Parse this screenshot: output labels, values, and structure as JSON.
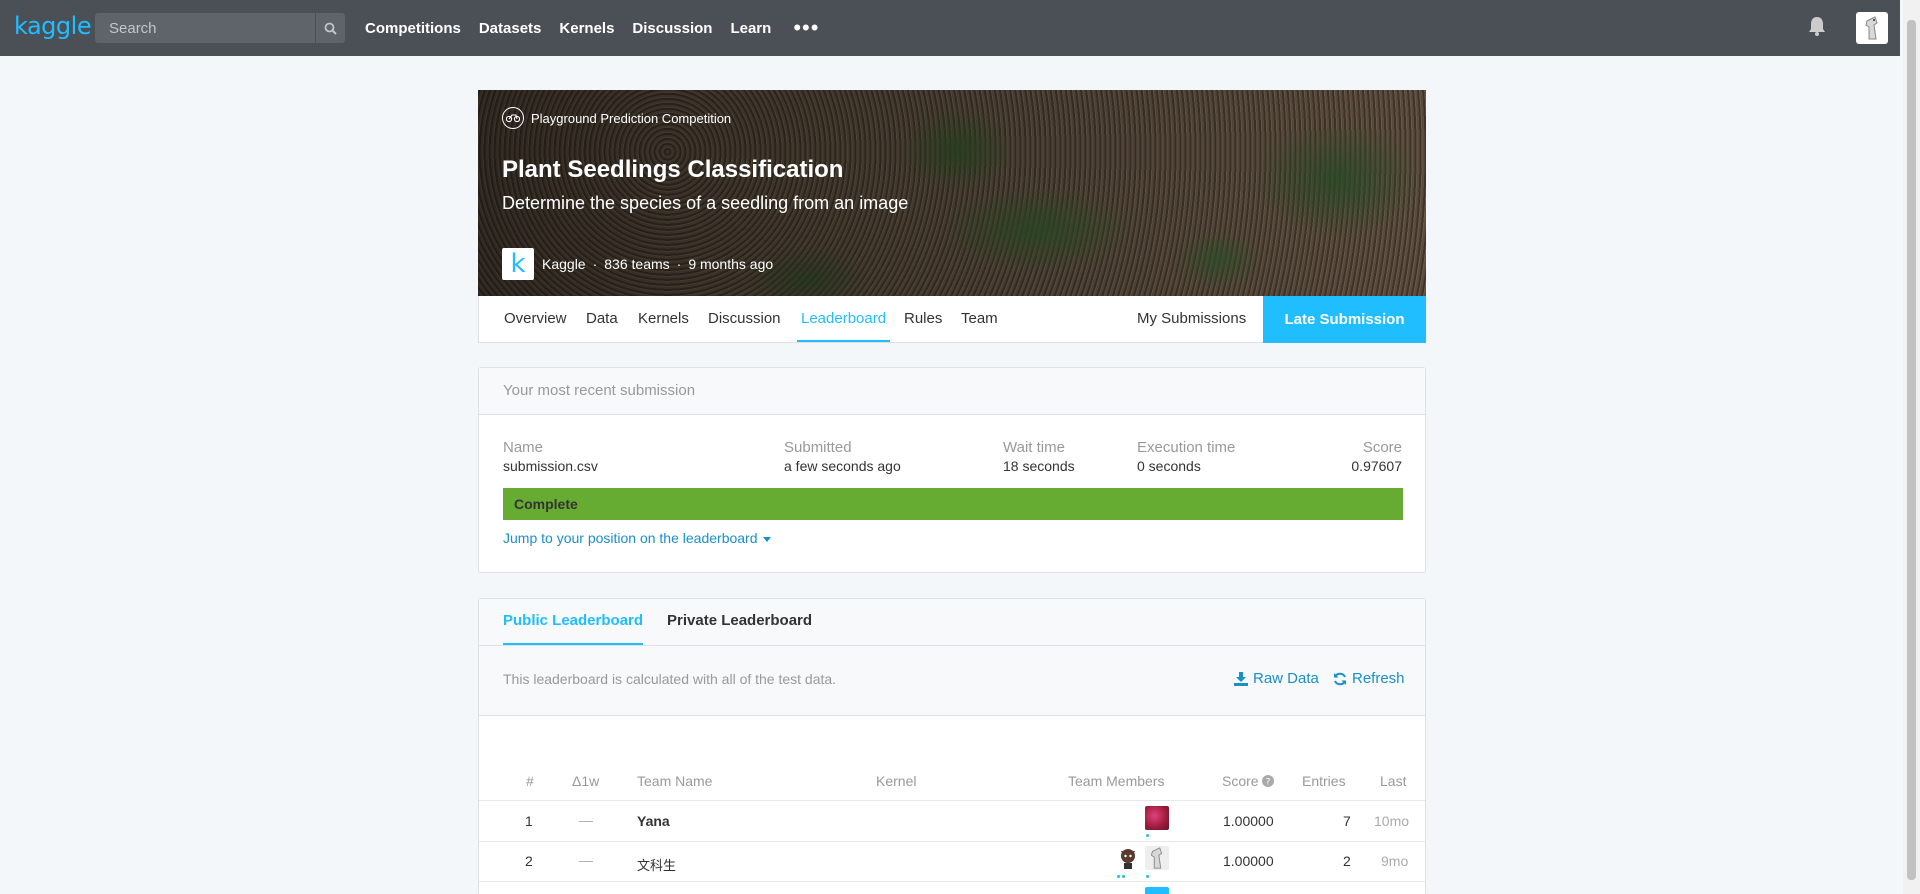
{
  "nav": {
    "logo": "kaggle",
    "search_placeholder": "Search",
    "links": [
      "Competitions",
      "Datasets",
      "Kernels",
      "Discussion",
      "Learn"
    ],
    "more": "•••"
  },
  "competition": {
    "type": "Playground Prediction Competition",
    "title": "Plant Seedlings Classification",
    "subtitle": "Determine the species of a seedling from an image",
    "host_logo": "k",
    "host": "Kaggle",
    "teams": "836 teams",
    "age": "9 months ago"
  },
  "tabs": {
    "items": [
      "Overview",
      "Data",
      "Kernels",
      "Discussion",
      "Leaderboard",
      "Rules",
      "Team"
    ],
    "active": "Leaderboard",
    "my_submissions": "My Submissions",
    "late_submission": "Late Submission"
  },
  "submission": {
    "header": "Your most recent submission",
    "name_label": "Name",
    "name": "submission.csv",
    "submitted_label": "Submitted",
    "submitted": "a few seconds ago",
    "wait_label": "Wait time",
    "wait": "18 seconds",
    "exec_label": "Execution time",
    "exec": "0 seconds",
    "score_label": "Score",
    "score": "0.97607",
    "status": "Complete",
    "jump_link": "Jump to your position on the leaderboard"
  },
  "leaderboard": {
    "tabs": [
      "Public Leaderboard",
      "Private Leaderboard"
    ],
    "info": "This leaderboard is calculated with all of the test data.",
    "raw_data": "Raw Data",
    "refresh": "Refresh",
    "columns": {
      "rank": "#",
      "delta": "Δ1w",
      "team": "Team Name",
      "kernel": "Kernel",
      "members": "Team Members",
      "score": "Score",
      "entries": "Entries",
      "last": "Last"
    },
    "rows": [
      {
        "rank": "1",
        "delta": "—",
        "team": "Yana",
        "score": "1.00000",
        "entries": "7",
        "last": "10mo"
      },
      {
        "rank": "2",
        "delta": "—",
        "team": "文科生",
        "score": "1.00000",
        "entries": "2",
        "last": "9mo"
      }
    ]
  },
  "colors": {
    "accent": "#20beff",
    "nav_bg": "#4b4f56",
    "complete": "#67ac32",
    "link": "#1a8fc9"
  }
}
